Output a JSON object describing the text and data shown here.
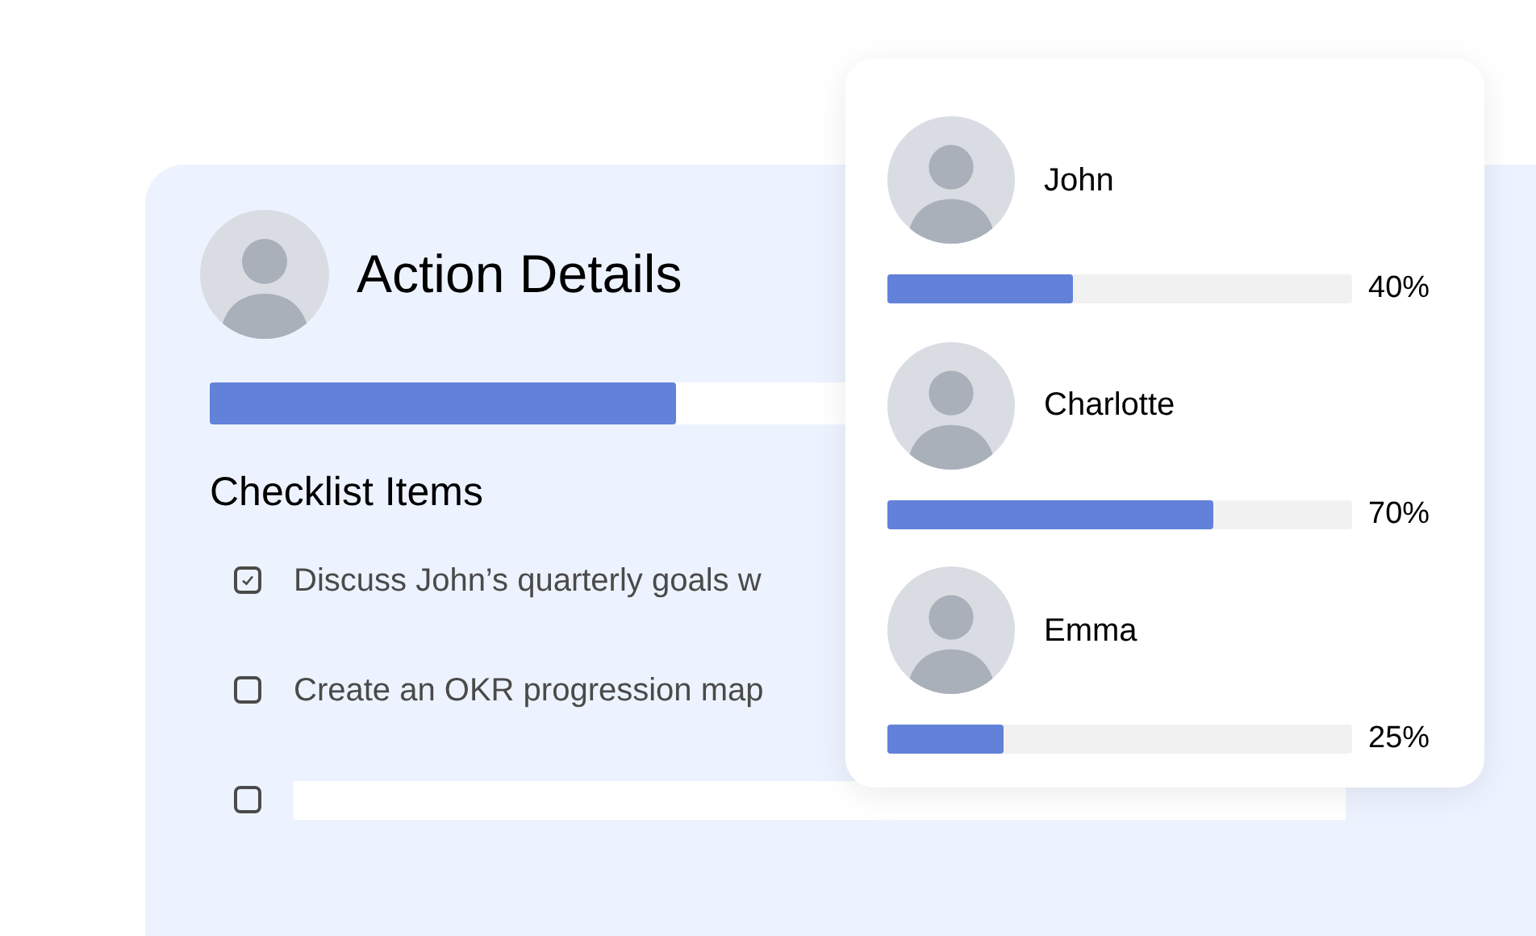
{
  "action": {
    "title": "Action Details",
    "level": 0.41
  },
  "checklist": {
    "heading": "Checklist Items",
    "items": [
      {
        "kind": "item",
        "text": "Discuss John’s quarterly goals w",
        "checked": true
      },
      {
        "kind": "item",
        "text": "Create an OKR progression map",
        "checked": false
      },
      {
        "kind": "input",
        "checked": false
      }
    ]
  },
  "people": [
    {
      "name": "John",
      "level": 0.4,
      "reading": "40%"
    },
    {
      "name": "Charlotte",
      "level": 0.7,
      "reading": "70%"
    },
    {
      "name": "Emma",
      "level": 0.25,
      "reading": "25%"
    }
  ]
}
